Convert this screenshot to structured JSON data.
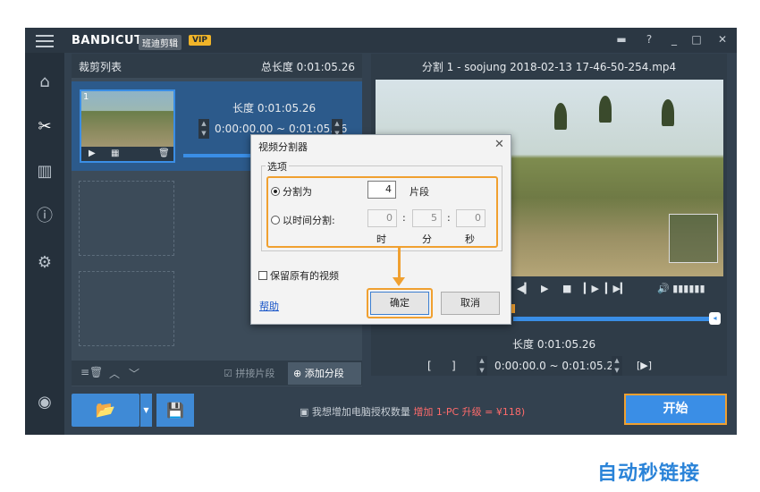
{
  "app": {
    "logo_main": "BANDICUT",
    "logo_cn": "班迪剪辑",
    "vip": "VIP"
  },
  "left_panel": {
    "title": "裁剪列表",
    "total_length": "总长度 0:01:05.26",
    "clip_number": "1",
    "clip_length": "长度 0:01:05.26",
    "clip_range": "0:00:00.00 ~ 0:01:05.26",
    "join_label": "拼接片段",
    "add_segment": "添加分段"
  },
  "right_panel": {
    "title": "分割 1 - soojung 2018-02-13 17-46-50-254.mp4",
    "length": "长度 0:01:05.26",
    "range": "0:00:00.0  ~  0:01:05.2"
  },
  "bottom": {
    "promo_text": "我想增加电脑授权数量",
    "promo_highlight": "增加 1-PC 升级 = ¥118)",
    "start": "开始"
  },
  "dialog": {
    "title": "视频分割器",
    "group_label": "选项",
    "split_by_count_label": "分割为",
    "split_count": "4",
    "segments_unit": "片段",
    "split_by_time_label": "以时间分割:",
    "hours": "0",
    "minutes": "5",
    "seconds": "0",
    "hour_unit": "时",
    "minute_unit": "分",
    "second_unit": "秒",
    "keep_original": "保留原有的视频",
    "help": "帮助",
    "ok": "确定",
    "cancel": "取消",
    "close": "✕"
  },
  "watermark": "自动秒链接",
  "colors": {
    "accent": "#3a8ee6",
    "highlight": "#f0a030",
    "bg": "#33414f"
  }
}
